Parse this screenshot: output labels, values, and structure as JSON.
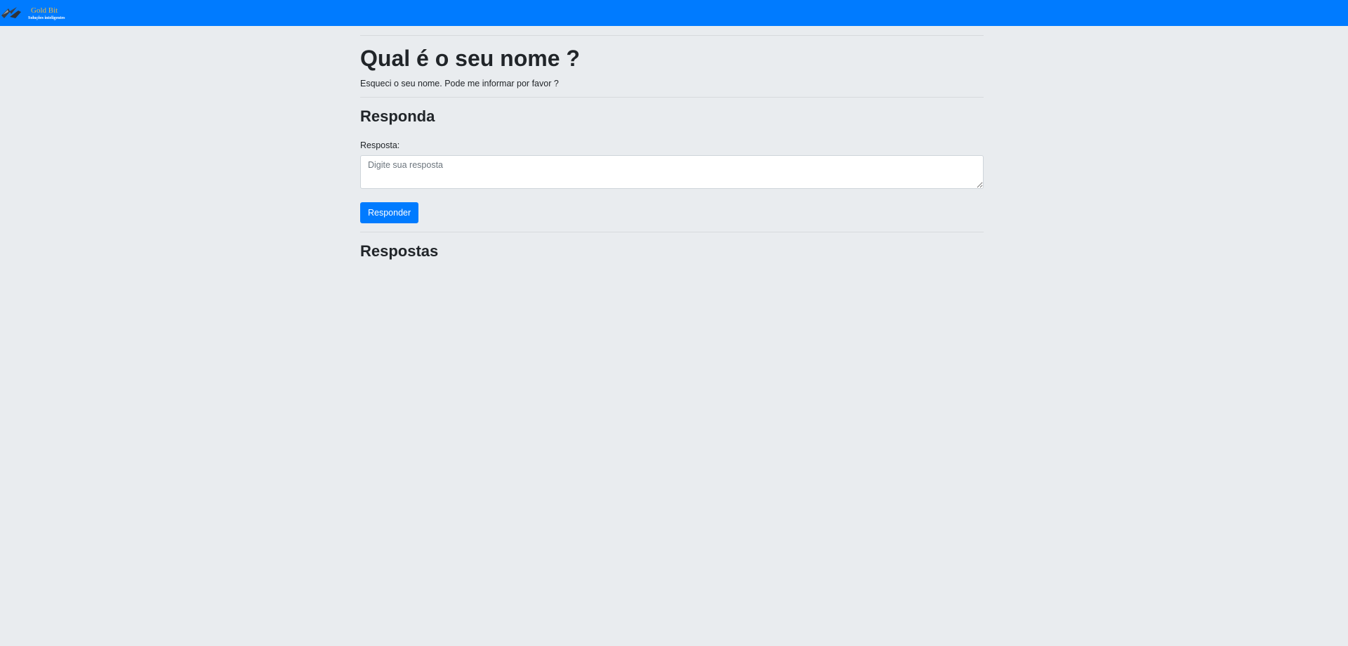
{
  "header": {
    "brand_name": "Gold Bit",
    "brand_tagline": "Soluções inteligentes",
    "logo_icon": "lightning-bolt-icon",
    "background_color": "#007bff",
    "brand_name_color": "#e8b84a"
  },
  "question": {
    "title": "Qual é o seu nome ?",
    "description": "Esqueci o seu nome. Pode me informar por favor ?"
  },
  "answer_form": {
    "section_title": "Responda",
    "label": "Resposta:",
    "placeholder": "Digite sua resposta",
    "value": "",
    "submit_label": "Responder",
    "accent_color": "#007bff"
  },
  "answers": {
    "section_title": "Respostas",
    "items": []
  }
}
